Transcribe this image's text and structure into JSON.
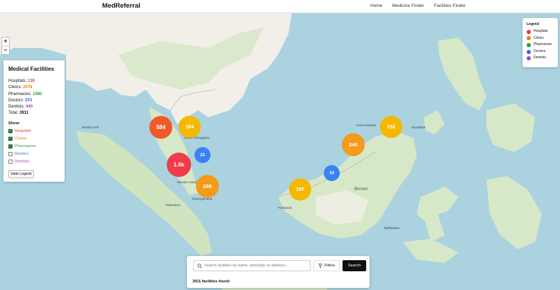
{
  "app": {
    "brand": "MedReferral"
  },
  "nav": {
    "links": [
      "Home",
      "Medicine Finder",
      "Facilities Finder"
    ]
  },
  "zoom": {
    "in": "+",
    "out": "−"
  },
  "panel": {
    "title": "Medical Facilities",
    "stats": [
      {
        "label": "Hospitals:",
        "value": "130",
        "color": "#e53935"
      },
      {
        "label": "Clinics:",
        "value": "2078",
        "color": "#f57c00"
      },
      {
        "label": "Pharmacies:",
        "value": "1060",
        "color": "#2e9e44"
      },
      {
        "label": "Doctors:",
        "value": "203",
        "color": "#2f6fd6"
      },
      {
        "label": "Dentists:",
        "value": "440",
        "color": "#b040c8"
      },
      {
        "label": "Total:",
        "value": "3911",
        "color": "#111111"
      }
    ],
    "show_label": "Show:",
    "filters": [
      {
        "label": "Hospitals",
        "checked": true,
        "color": "#e53935"
      },
      {
        "label": "Clinics",
        "checked": true,
        "color": "#f57c00"
      },
      {
        "label": "Pharmacies",
        "checked": true,
        "color": "#2e9e44"
      },
      {
        "label": "Doctors",
        "checked": false,
        "color": "#2f6fd6"
      },
      {
        "label": "Dentists",
        "checked": false,
        "color": "#b040c8"
      }
    ],
    "hide_button": "Hide Legend"
  },
  "legend": {
    "title": "Legend",
    "items": [
      {
        "label": "Hospitals",
        "color": "#e53935"
      },
      {
        "label": "Clinics",
        "color": "#f57c00"
      },
      {
        "label": "Pharmacies",
        "color": "#2e9e44"
      },
      {
        "label": "Doctors",
        "color": "#2f6fd6"
      },
      {
        "label": "Dentists",
        "color": "#b040c8"
      }
    ]
  },
  "clusters": [
    {
      "label": "584",
      "color": "#f05a2a"
    },
    {
      "label": "184",
      "color": "#f5b800"
    },
    {
      "label": "22",
      "color": "#3b82f6"
    },
    {
      "label": "1.6k",
      "color": "#ef3b4a"
    },
    {
      "label": "296",
      "color": "#f59a1a"
    },
    {
      "label": "160",
      "color": "#f5b800"
    },
    {
      "label": "24",
      "color": "#3b82f6"
    },
    {
      "label": "240",
      "color": "#f59a1a"
    },
    {
      "label": "152",
      "color": "#f5b800"
    }
  ],
  "map_labels": [
    "Borneo",
    "Kota Kinabalu",
    "Sandakan",
    "Pekanbaru",
    "Pontianak",
    "Balikpapan",
    "Kuala Terengganu",
    "Bandar Lampung",
    "Banda Aceh",
    "Tanjungpinang"
  ],
  "search": {
    "placeholder": "Search facilities by name, specialty, or address...",
    "filters_label": "Filters",
    "button_label": "Search",
    "results_text": "3911 facilities found"
  }
}
